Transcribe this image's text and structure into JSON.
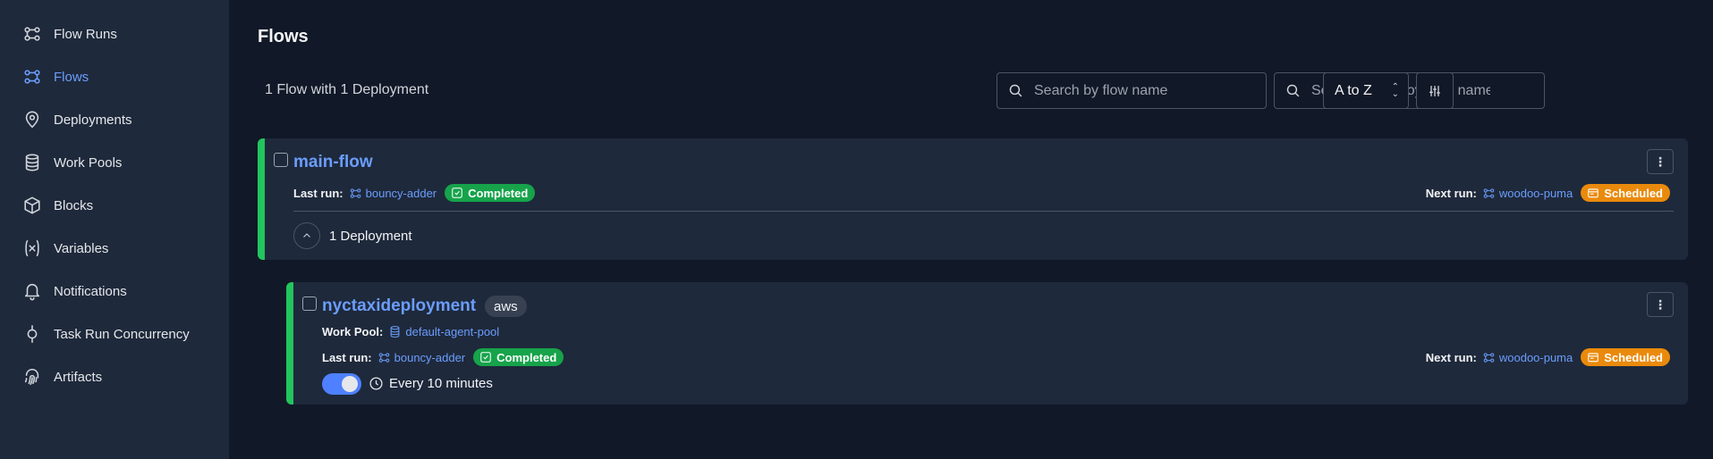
{
  "sidebar": {
    "items": [
      {
        "label": "Flow Runs",
        "icon": "flow-runs-icon"
      },
      {
        "label": "Flows",
        "icon": "flows-icon",
        "active": true
      },
      {
        "label": "Deployments",
        "icon": "map-pin-icon"
      },
      {
        "label": "Work Pools",
        "icon": "database-icon"
      },
      {
        "label": "Blocks",
        "icon": "cube-icon"
      },
      {
        "label": "Variables",
        "icon": "variable-icon"
      },
      {
        "label": "Notifications",
        "icon": "bell-icon"
      },
      {
        "label": "Task Run Concurrency",
        "icon": "concurrency-icon"
      },
      {
        "label": "Artifacts",
        "icon": "fingerprint-icon"
      }
    ]
  },
  "main": {
    "title": "Flows",
    "summary": "1 Flow with 1 Deployment",
    "search_flow_placeholder": "Search by flow name",
    "search_deployment_placeholder": "Search by deployment name",
    "sort_value": "A to Z"
  },
  "flow": {
    "name": "main-flow",
    "last_run_label": "Last run:",
    "last_run_name": "bouncy-adder",
    "last_run_status": "Completed",
    "next_run_label": "Next run:",
    "next_run_name": "woodoo-puma",
    "next_run_status": "Scheduled",
    "deployments_label": "1 Deployment"
  },
  "deployment": {
    "name": "nyctaxideployment",
    "tag": "aws",
    "work_pool_label": "Work Pool:",
    "work_pool_name": "default-agent-pool",
    "last_run_label": "Last run:",
    "last_run_name": "bouncy-adder",
    "last_run_status": "Completed",
    "next_run_label": "Next run:",
    "next_run_name": "woodoo-puma",
    "next_run_status": "Scheduled",
    "schedule_enabled": true,
    "schedule": "Every 10 minutes"
  },
  "colors": {
    "accent": "#6b9dfc",
    "completed": "#16a34a",
    "scheduled": "#ea8a0c",
    "card_border": "#22c55e"
  }
}
